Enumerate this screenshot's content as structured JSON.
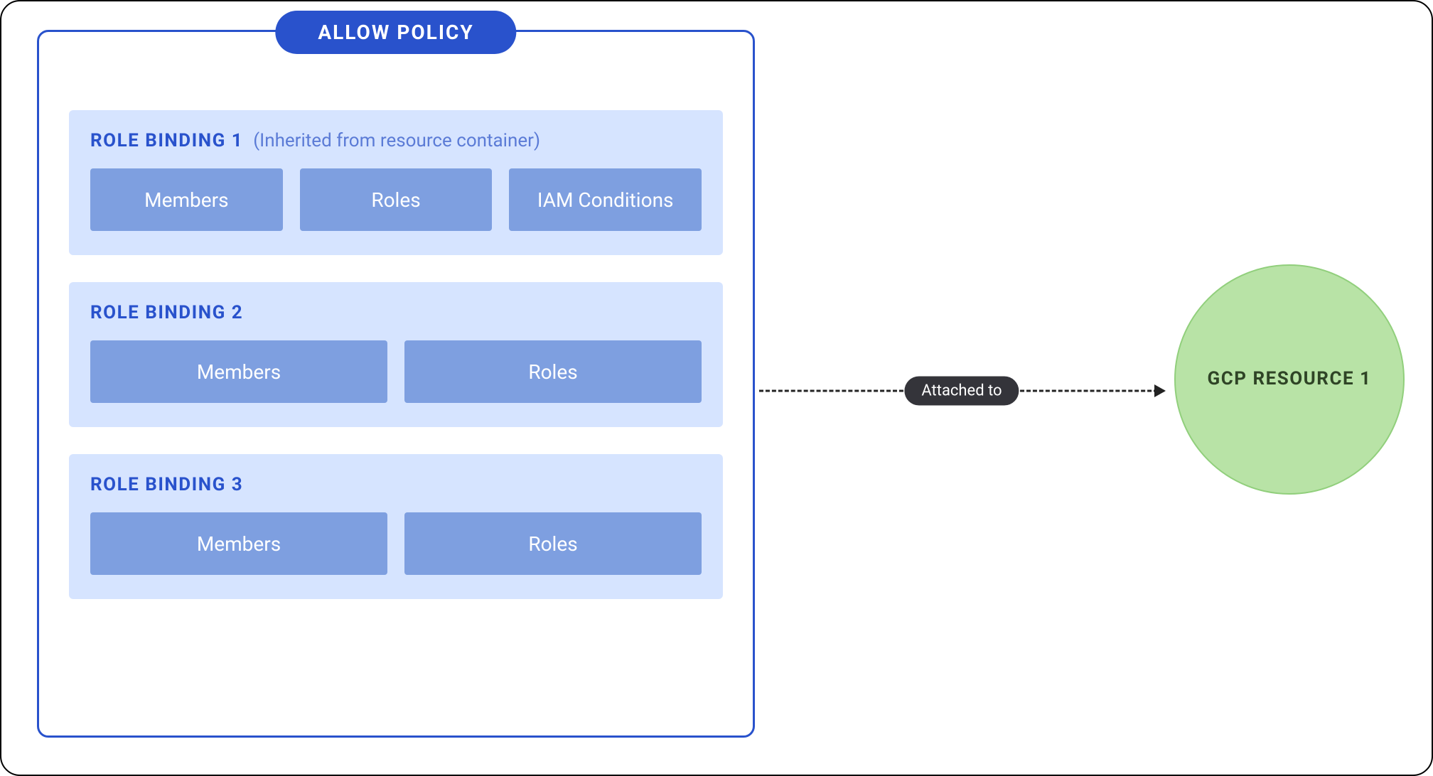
{
  "policy": {
    "badge": "ALLOW POLICY",
    "bindings": [
      {
        "title": "ROLE BINDING 1",
        "note": "(Inherited from resource container)",
        "chips": [
          "Members",
          "Roles",
          "IAM Conditions"
        ]
      },
      {
        "title": "ROLE BINDING 2",
        "note": "",
        "chips": [
          "Members",
          "Roles"
        ]
      },
      {
        "title": "ROLE BINDING 3",
        "note": "",
        "chips": [
          "Members",
          "Roles"
        ]
      }
    ]
  },
  "connector": {
    "label": "Attached to"
  },
  "resource": {
    "label": "GCP RESOURCE 1"
  },
  "colors": {
    "policy_border": "#2952cc",
    "binding_bg": "#d6e4ff",
    "chip_bg": "#7e9fe0",
    "resource_bg": "#b8e3a6"
  }
}
